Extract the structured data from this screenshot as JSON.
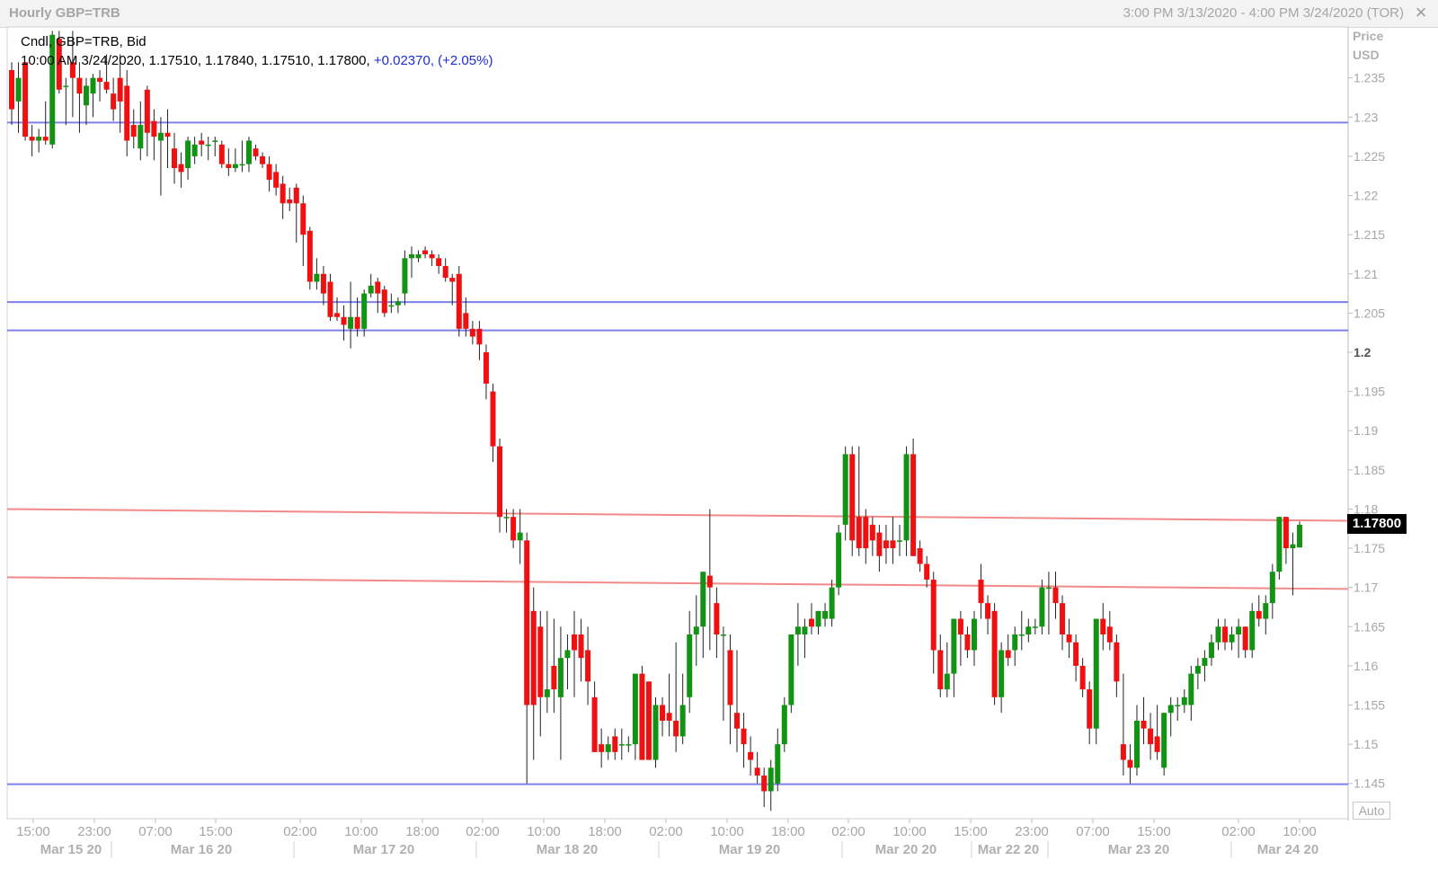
{
  "window": {
    "title": "Hourly GBP=TRB",
    "range": "3:00 PM 3/13/2020 - 4:00 PM 3/24/2020 (TOR)",
    "close_icon": "close-icon"
  },
  "legend": {
    "line1": "Cndl, GBP=TRB, Bid",
    "line2": "10:00 AM 3/24/2020, 1.17510, 1.17840, 1.17510, 1.17800, ",
    "change": "+0.02370, (+2.05%)"
  },
  "price_axis": {
    "title_line1": "Price",
    "title_line2": "USD",
    "auto_label": "Auto",
    "last_price": "1.17800"
  },
  "colors": {
    "up": "#139313",
    "down": "#ef1111",
    "support_line": "#7f7fee",
    "trend_line": "#f28a8a",
    "grid": "#e6e6e6"
  },
  "chart_data": {
    "type": "candlestick",
    "title": "Hourly GBP=TRB",
    "ylabel": "Price USD",
    "ylim": [
      1.1405,
      1.2415
    ],
    "y_ticks": [
      "1.235",
      "1.23",
      "1.225",
      "1.22",
      "1.215",
      "1.21",
      "1.205",
      "1.2",
      "1.195",
      "1.19",
      "1.185",
      "1.18",
      "1.175",
      "1.17",
      "1.165",
      "1.16",
      "1.155",
      "1.15",
      "1.145"
    ],
    "x_tick_labels": [
      "15:00",
      "23:00",
      "07:00",
      "15:00",
      "02:00",
      "10:00",
      "18:00",
      "02:00",
      "10:00",
      "18:00",
      "02:00",
      "10:00",
      "18:00",
      "02:00",
      "10:00",
      "15:00",
      "23:00",
      "07:00",
      "15:00",
      "02:00",
      "10:00"
    ],
    "date_labels": [
      "Mar 15 20",
      "Mar 16 20",
      "Mar 17 20",
      "Mar 18 20",
      "Mar 19 20",
      "Mar 20 20",
      "Mar 22 20",
      "Mar 23 20",
      "Mar 24 20"
    ],
    "horizontal_lines": [
      1.2293,
      1.2064,
      1.2028,
      1.1449
    ],
    "trend_lines": [
      {
        "start": 1.18,
        "end": 1.1785
      },
      {
        "start": 1.1713,
        "end": 1.1698
      }
    ],
    "candles": [
      [
        1.236,
        1.237,
        1.229,
        1.231
      ],
      [
        1.232,
        1.237,
        1.228,
        1.235
      ],
      [
        1.237,
        1.237,
        1.227,
        1.2275
      ],
      [
        1.2275,
        1.229,
        1.225,
        1.227
      ],
      [
        1.227,
        1.2285,
        1.2255,
        1.2275
      ],
      [
        1.2275,
        1.232,
        1.2265,
        1.227
      ],
      [
        1.2265,
        1.241,
        1.226,
        1.2405
      ],
      [
        1.24,
        1.241,
        1.233,
        1.2335
      ],
      [
        1.234,
        1.235,
        1.229,
        1.234
      ],
      [
        1.237,
        1.241,
        1.23,
        1.235
      ],
      [
        1.235,
        1.237,
        1.228,
        1.233
      ],
      [
        1.2315,
        1.235,
        1.229,
        1.234
      ],
      [
        1.233,
        1.2355,
        1.23,
        1.235
      ],
      [
        1.235,
        1.236,
        1.232,
        1.2345
      ],
      [
        1.2345,
        1.238,
        1.233,
        1.2335
      ],
      [
        1.233,
        1.235,
        1.2295,
        1.231
      ],
      [
        1.235,
        1.238,
        1.228,
        1.232
      ],
      [
        1.234,
        1.236,
        1.225,
        1.227
      ],
      [
        1.229,
        1.231,
        1.226,
        1.2275
      ],
      [
        1.226,
        1.232,
        1.2245,
        1.229
      ],
      [
        1.2335,
        1.234,
        1.225,
        1.228
      ],
      [
        1.2295,
        1.231,
        1.2245,
        1.2275
      ],
      [
        1.227,
        1.23,
        1.22,
        1.228
      ],
      [
        1.228,
        1.231,
        1.2235,
        1.2275
      ],
      [
        1.226,
        1.228,
        1.2215,
        1.2235
      ],
      [
        1.224,
        1.2255,
        1.221,
        1.223
      ],
      [
        1.2235,
        1.2275,
        1.222,
        1.227
      ],
      [
        1.225,
        1.2275,
        1.224,
        1.2265
      ],
      [
        1.227,
        1.228,
        1.225,
        1.2265
      ],
      [
        1.2265,
        1.2275,
        1.2245,
        1.2265
      ],
      [
        1.227,
        1.2275,
        1.225,
        1.227
      ],
      [
        1.2265,
        1.227,
        1.2235,
        1.224
      ],
      [
        1.224,
        1.226,
        1.2225,
        1.2235
      ],
      [
        1.2235,
        1.226,
        1.223,
        1.224
      ],
      [
        1.224,
        1.227,
        1.223,
        1.224
      ],
      [
        1.224,
        1.2275,
        1.223,
        1.227
      ],
      [
        1.226,
        1.2265,
        1.2245,
        1.225
      ],
      [
        1.225,
        1.2255,
        1.2235,
        1.224
      ],
      [
        1.224,
        1.225,
        1.2205,
        1.222
      ],
      [
        1.223,
        1.224,
        1.22,
        1.221
      ],
      [
        1.2215,
        1.2225,
        1.217,
        1.219
      ],
      [
        1.2195,
        1.221,
        1.218,
        1.219
      ],
      [
        1.221,
        1.2215,
        1.214,
        1.219
      ],
      [
        1.219,
        1.22,
        1.211,
        1.215
      ],
      [
        1.2155,
        1.216,
        1.208,
        1.209
      ],
      [
        1.209,
        1.212,
        1.208,
        1.21
      ],
      [
        1.21,
        1.211,
        1.206,
        1.2075
      ],
      [
        1.209,
        1.21,
        1.204,
        1.2045
      ],
      [
        1.205,
        1.207,
        1.204,
        1.2045
      ],
      [
        1.2045,
        1.206,
        1.2015,
        1.2035
      ],
      [
        1.203,
        1.209,
        1.2005,
        1.2045
      ],
      [
        1.2045,
        1.207,
        1.202,
        1.203
      ],
      [
        1.203,
        1.208,
        1.202,
        1.2075
      ],
      [
        1.2075,
        1.21,
        1.207,
        1.2085
      ],
      [
        1.209,
        1.2095,
        1.205,
        1.2075
      ],
      [
        1.208,
        1.2085,
        1.2045,
        1.205
      ],
      [
        1.206,
        1.2075,
        1.205,
        1.206
      ],
      [
        1.206,
        1.207,
        1.205,
        1.2065
      ],
      [
        1.2075,
        1.213,
        1.206,
        1.212
      ],
      [
        1.212,
        1.2135,
        1.2095,
        1.2125
      ],
      [
        1.212,
        1.213,
        1.2115,
        1.2125
      ],
      [
        1.213,
        1.2135,
        1.212,
        1.2125
      ],
      [
        1.2125,
        1.213,
        1.211,
        1.212
      ],
      [
        1.212,
        1.2125,
        1.21,
        1.211
      ],
      [
        1.211,
        1.212,
        1.209,
        1.2095
      ],
      [
        1.2095,
        1.21,
        1.206,
        1.209
      ],
      [
        1.21,
        1.211,
        1.202,
        1.203
      ],
      [
        1.205,
        1.207,
        1.202,
        1.203
      ],
      [
        1.203,
        1.204,
        1.201,
        1.202
      ],
      [
        1.203,
        1.204,
        1.199,
        1.201
      ],
      [
        1.2,
        1.201,
        1.194,
        1.196
      ],
      [
        1.195,
        1.196,
        1.186,
        1.188
      ],
      [
        1.188,
        1.189,
        1.177,
        1.179
      ],
      [
        1.179,
        1.18,
        1.177,
        1.179
      ],
      [
        1.179,
        1.18,
        1.175,
        1.176
      ],
      [
        1.176,
        1.18,
        1.173,
        1.177
      ],
      [
        1.176,
        1.177,
        1.145,
        1.155
      ],
      [
        1.167,
        1.17,
        1.148,
        1.155
      ],
      [
        1.165,
        1.167,
        1.151,
        1.156
      ],
      [
        1.156,
        1.167,
        1.154,
        1.157
      ],
      [
        1.16,
        1.166,
        1.154,
        1.157
      ],
      [
        1.156,
        1.165,
        1.148,
        1.161
      ],
      [
        1.161,
        1.164,
        1.157,
        1.162
      ],
      [
        1.164,
        1.167,
        1.156,
        1.162
      ],
      [
        1.164,
        1.166,
        1.158,
        1.161
      ],
      [
        1.162,
        1.165,
        1.155,
        1.158
      ],
      [
        1.156,
        1.158,
        1.149,
        1.149
      ],
      [
        1.15,
        1.152,
        1.147,
        1.149
      ],
      [
        1.149,
        1.151,
        1.148,
        1.15
      ],
      [
        1.151,
        1.152,
        1.148,
        1.149
      ],
      [
        1.15,
        1.152,
        1.148,
        1.15
      ],
      [
        1.15,
        1.151,
        1.149,
        1.15
      ],
      [
        1.15,
        1.159,
        1.148,
        1.159
      ],
      [
        1.159,
        1.16,
        1.148,
        1.148
      ],
      [
        1.158,
        1.158,
        1.148,
        1.148
      ],
      [
        1.148,
        1.156,
        1.147,
        1.155
      ],
      [
        1.155,
        1.156,
        1.151,
        1.153
      ],
      [
        1.154,
        1.159,
        1.151,
        1.153
      ],
      [
        1.153,
        1.163,
        1.149,
        1.151
      ],
      [
        1.151,
        1.159,
        1.15,
        1.155
      ],
      [
        1.156,
        1.167,
        1.154,
        1.164
      ],
      [
        1.164,
        1.169,
        1.16,
        1.165
      ],
      [
        1.165,
        1.172,
        1.161,
        1.172
      ],
      [
        1.1715,
        1.18,
        1.162,
        1.17
      ],
      [
        1.168,
        1.17,
        1.161,
        1.164
      ],
      [
        1.164,
        1.165,
        1.153,
        1.164
      ],
      [
        1.162,
        1.164,
        1.15,
        1.155
      ],
      [
        1.154,
        1.162,
        1.149,
        1.152
      ],
      [
        1.152,
        1.154,
        1.147,
        1.15
      ],
      [
        1.149,
        1.151,
        1.146,
        1.148
      ],
      [
        1.147,
        1.149,
        1.145,
        1.146
      ],
      [
        1.146,
        1.147,
        1.142,
        1.144
      ],
      [
        1.144,
        1.148,
        1.1415,
        1.147
      ],
      [
        1.145,
        1.152,
        1.144,
        1.15
      ],
      [
        1.15,
        1.156,
        1.149,
        1.155
      ],
      [
        1.155,
        1.164,
        1.154,
        1.164
      ],
      [
        1.164,
        1.168,
        1.16,
        1.165
      ],
      [
        1.164,
        1.166,
        1.161,
        1.165
      ],
      [
        1.166,
        1.168,
        1.164,
        1.165
      ],
      [
        1.165,
        1.167,
        1.164,
        1.167
      ],
      [
        1.166,
        1.168,
        1.165,
        1.167
      ],
      [
        1.166,
        1.171,
        1.165,
        1.17
      ],
      [
        1.17,
        1.178,
        1.169,
        1.177
      ],
      [
        1.178,
        1.188,
        1.176,
        1.187
      ],
      [
        1.187,
        1.188,
        1.174,
        1.176
      ],
      [
        1.179,
        1.188,
        1.174,
        1.175
      ],
      [
        1.179,
        1.18,
        1.173,
        1.175
      ],
      [
        1.178,
        1.179,
        1.174,
        1.176
      ],
      [
        1.177,
        1.178,
        1.172,
        1.174
      ],
      [
        1.176,
        1.178,
        1.173,
        1.175
      ],
      [
        1.176,
        1.179,
        1.173,
        1.175
      ],
      [
        1.176,
        1.178,
        1.174,
        1.176
      ],
      [
        1.176,
        1.188,
        1.174,
        1.187
      ],
      [
        1.187,
        1.189,
        1.174,
        1.174
      ],
      [
        1.175,
        1.176,
        1.172,
        1.173
      ],
      [
        1.173,
        1.174,
        1.17,
        1.171
      ],
      [
        1.171,
        1.172,
        1.159,
        1.162
      ],
      [
        1.162,
        1.164,
        1.156,
        1.157
      ],
      [
        1.157,
        1.163,
        1.156,
        1.159
      ],
      [
        1.159,
        1.166,
        1.156,
        1.166
      ],
      [
        1.166,
        1.167,
        1.16,
        1.164
      ],
      [
        1.164,
        1.165,
        1.161,
        1.162
      ],
      [
        1.162,
        1.167,
        1.16,
        1.166
      ],
      [
        1.171,
        1.173,
        1.166,
        1.168
      ],
      [
        1.168,
        1.169,
        1.164,
        1.166
      ],
      [
        1.167,
        1.168,
        1.155,
        1.156
      ],
      [
        1.156,
        1.163,
        1.154,
        1.162
      ],
      [
        1.162,
        1.164,
        1.16,
        1.161
      ],
      [
        1.162,
        1.165,
        1.16,
        1.164
      ],
      [
        1.164,
        1.167,
        1.162,
        1.164
      ],
      [
        1.164,
        1.166,
        1.163,
        1.165
      ],
      [
        1.165,
        1.166,
        1.164,
        1.165
      ],
      [
        1.165,
        1.171,
        1.164,
        1.17
      ],
      [
        1.17,
        1.172,
        1.164,
        1.17
      ],
      [
        1.17,
        1.172,
        1.166,
        1.168
      ],
      [
        1.168,
        1.169,
        1.162,
        1.164
      ],
      [
        1.164,
        1.166,
        1.161,
        1.163
      ],
      [
        1.163,
        1.164,
        1.158,
        1.16
      ],
      [
        1.16,
        1.161,
        1.156,
        1.157
      ],
      [
        1.157,
        1.158,
        1.15,
        1.152
      ],
      [
        1.152,
        1.166,
        1.15,
        1.166
      ],
      [
        1.166,
        1.168,
        1.162,
        1.164
      ],
      [
        1.165,
        1.167,
        1.162,
        1.163
      ],
      [
        1.163,
        1.164,
        1.156,
        1.158
      ],
      [
        1.15,
        1.159,
        1.146,
        1.148
      ],
      [
        1.148,
        1.15,
        1.145,
        1.147
      ],
      [
        1.147,
        1.155,
        1.146,
        1.153
      ],
      [
        1.153,
        1.156,
        1.15,
        1.152
      ],
      [
        1.152,
        1.154,
        1.148,
        1.15
      ],
      [
        1.151,
        1.155,
        1.148,
        1.149
      ],
      [
        1.147,
        1.154,
        1.146,
        1.154
      ],
      [
        1.154,
        1.156,
        1.151,
        1.155
      ],
      [
        1.155,
        1.156,
        1.153,
        1.155
      ],
      [
        1.155,
        1.157,
        1.154,
        1.156
      ],
      [
        1.155,
        1.16,
        1.153,
        1.159
      ],
      [
        1.159,
        1.161,
        1.157,
        1.16
      ],
      [
        1.16,
        1.162,
        1.158,
        1.161
      ],
      [
        1.161,
        1.164,
        1.16,
        1.163
      ],
      [
        1.163,
        1.166,
        1.162,
        1.165
      ],
      [
        1.165,
        1.166,
        1.162,
        1.163
      ],
      [
        1.163,
        1.165,
        1.162,
        1.164
      ],
      [
        1.164,
        1.166,
        1.161,
        1.165
      ],
      [
        1.165,
        1.165,
        1.161,
        1.162
      ],
      [
        1.162,
        1.168,
        1.161,
        1.167
      ],
      [
        1.167,
        1.169,
        1.165,
        1.166
      ],
      [
        1.166,
        1.169,
        1.164,
        1.168
      ],
      [
        1.168,
        1.173,
        1.166,
        1.172
      ],
      [
        1.172,
        1.179,
        1.171,
        1.179
      ],
      [
        1.179,
        1.179,
        1.173,
        1.175
      ],
      [
        1.175,
        1.177,
        1.169,
        1.1755
      ],
      [
        1.1751,
        1.1784,
        1.1751,
        1.178
      ]
    ]
  }
}
